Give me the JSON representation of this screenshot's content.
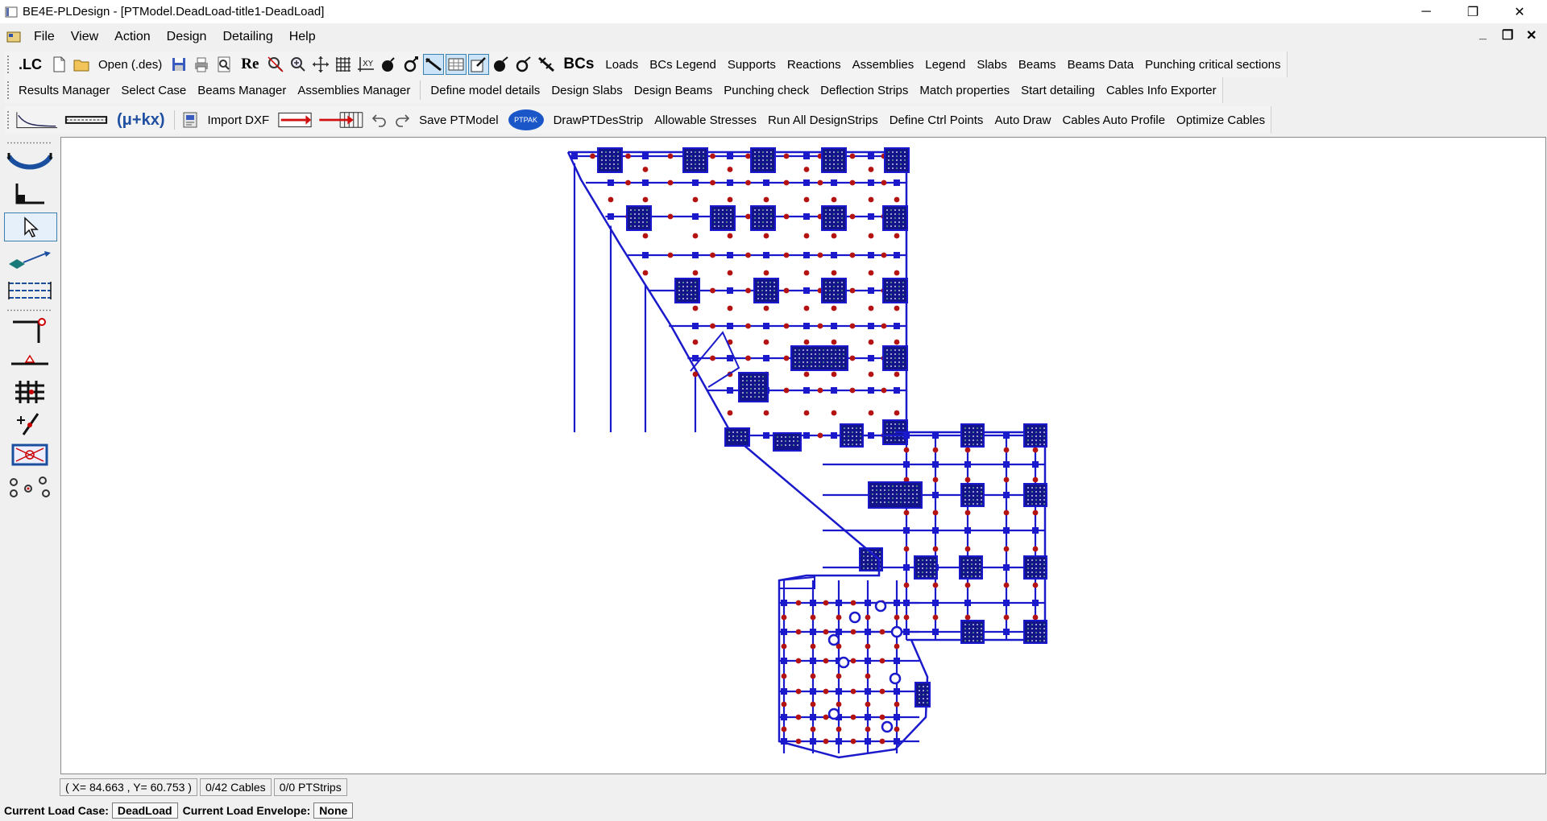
{
  "window": {
    "title": "BE4E-PLDesign - [PTModel.DeadLoad-title1-DeadLoad]",
    "minimize": "─",
    "restore": "❐",
    "close": "✕"
  },
  "menu": {
    "items": [
      "File",
      "View",
      "Action",
      "Design",
      "Detailing",
      "Help"
    ],
    "mdi_minimize": "_",
    "mdi_restore": "❐",
    "mdi_close": "✕"
  },
  "toolbar1": {
    "lc": ".LC",
    "open": "Open (.des)",
    "re": "Re",
    "bcs": "BCs",
    "items": [
      "Loads",
      "BCs Legend",
      "Supports",
      "Reactions",
      "Assemblies",
      "Legend",
      "Slabs",
      "Beams",
      "Beams Data",
      "Punching critical sections"
    ]
  },
  "toolbar2": {
    "items": [
      "Results Manager",
      "Select Case",
      "Beams Manager",
      "Assemblies Manager",
      "Define model details",
      "Design Slabs",
      "Design Beams",
      "Punching check",
      "Deflection Strips",
      "Match properties",
      "Start detailing",
      "Cables Info Exporter"
    ]
  },
  "toolbar3": {
    "formula": "(μ+kx)",
    "import_dxf": "Import DXF",
    "save": "Save PTModel",
    "ptpak": "PTPAK",
    "items": [
      "DrawPTDesStrip",
      "Allowable Stresses",
      "Run All DesignStrips",
      "Define Ctrl Points",
      "Auto Draw",
      "Cables Auto Profile",
      "Optimize Cables"
    ]
  },
  "left_tools": [
    "cable-curve-icon",
    "axis-corner-icon",
    "pointer-icon",
    "slab-node-icon",
    "strips-icon",
    "column-tee-icon",
    "support-icon",
    "grid-mesh-icon",
    "point-edit-icon",
    "box-cross-icon",
    "nodes-icon"
  ],
  "status": {
    "coords": "( X= 84.663 , Y= 60.753 )",
    "cables": "0/42 Cables",
    "strips": "0/0 PTStrips",
    "load_case_label": "Current Load Case:",
    "load_case": "DeadLoad",
    "envelope_label": "Current Load Envelope:",
    "envelope": "None"
  },
  "colors": {
    "model_line": "#1a1acc",
    "node": "#b51212",
    "column_fill": "#14148a",
    "column_dots": "#ffffff",
    "column_green": "#7fcf8a"
  }
}
